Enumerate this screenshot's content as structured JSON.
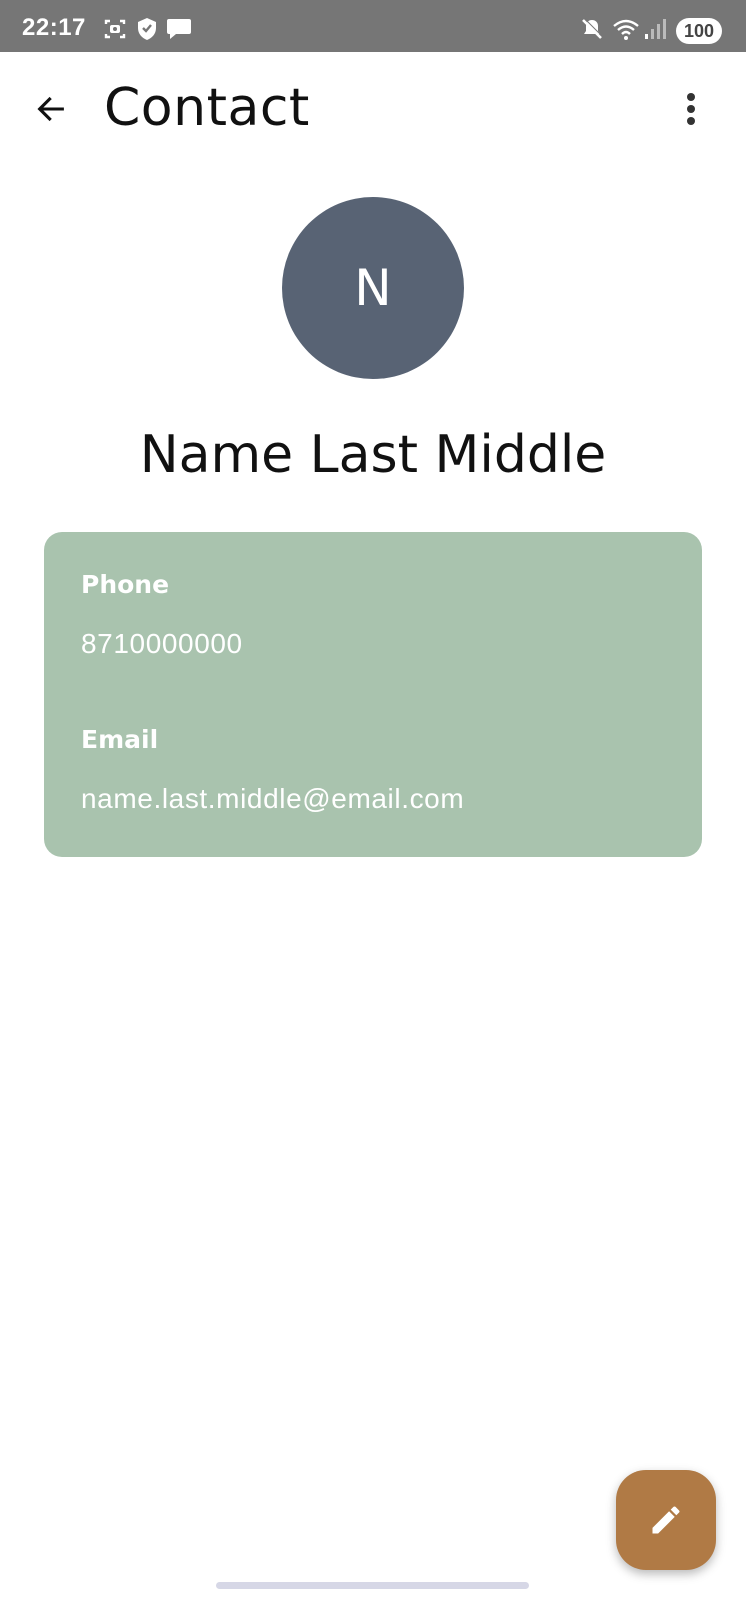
{
  "status_bar": {
    "time": "22:17",
    "battery": "100",
    "icons": [
      "screenshot-icon",
      "shield-icon",
      "message-icon",
      "mute-icon",
      "wifi-icon",
      "signal-icon",
      "battery-icon"
    ]
  },
  "app_bar": {
    "title": "Contact",
    "back_icon": "arrow-back-icon",
    "more_icon": "more-vert-icon"
  },
  "contact": {
    "initial": "N",
    "name": "Name Last Middle",
    "avatar_color": "#586374"
  },
  "details": {
    "card_color": "#a9c3ae",
    "phone_label": "Phone",
    "phone_value": "8710000000",
    "email_label": "Email",
    "email_value": "name.last.middle@email.com"
  },
  "fab": {
    "icon": "edit-pencil-icon",
    "color": "#b07a45"
  }
}
